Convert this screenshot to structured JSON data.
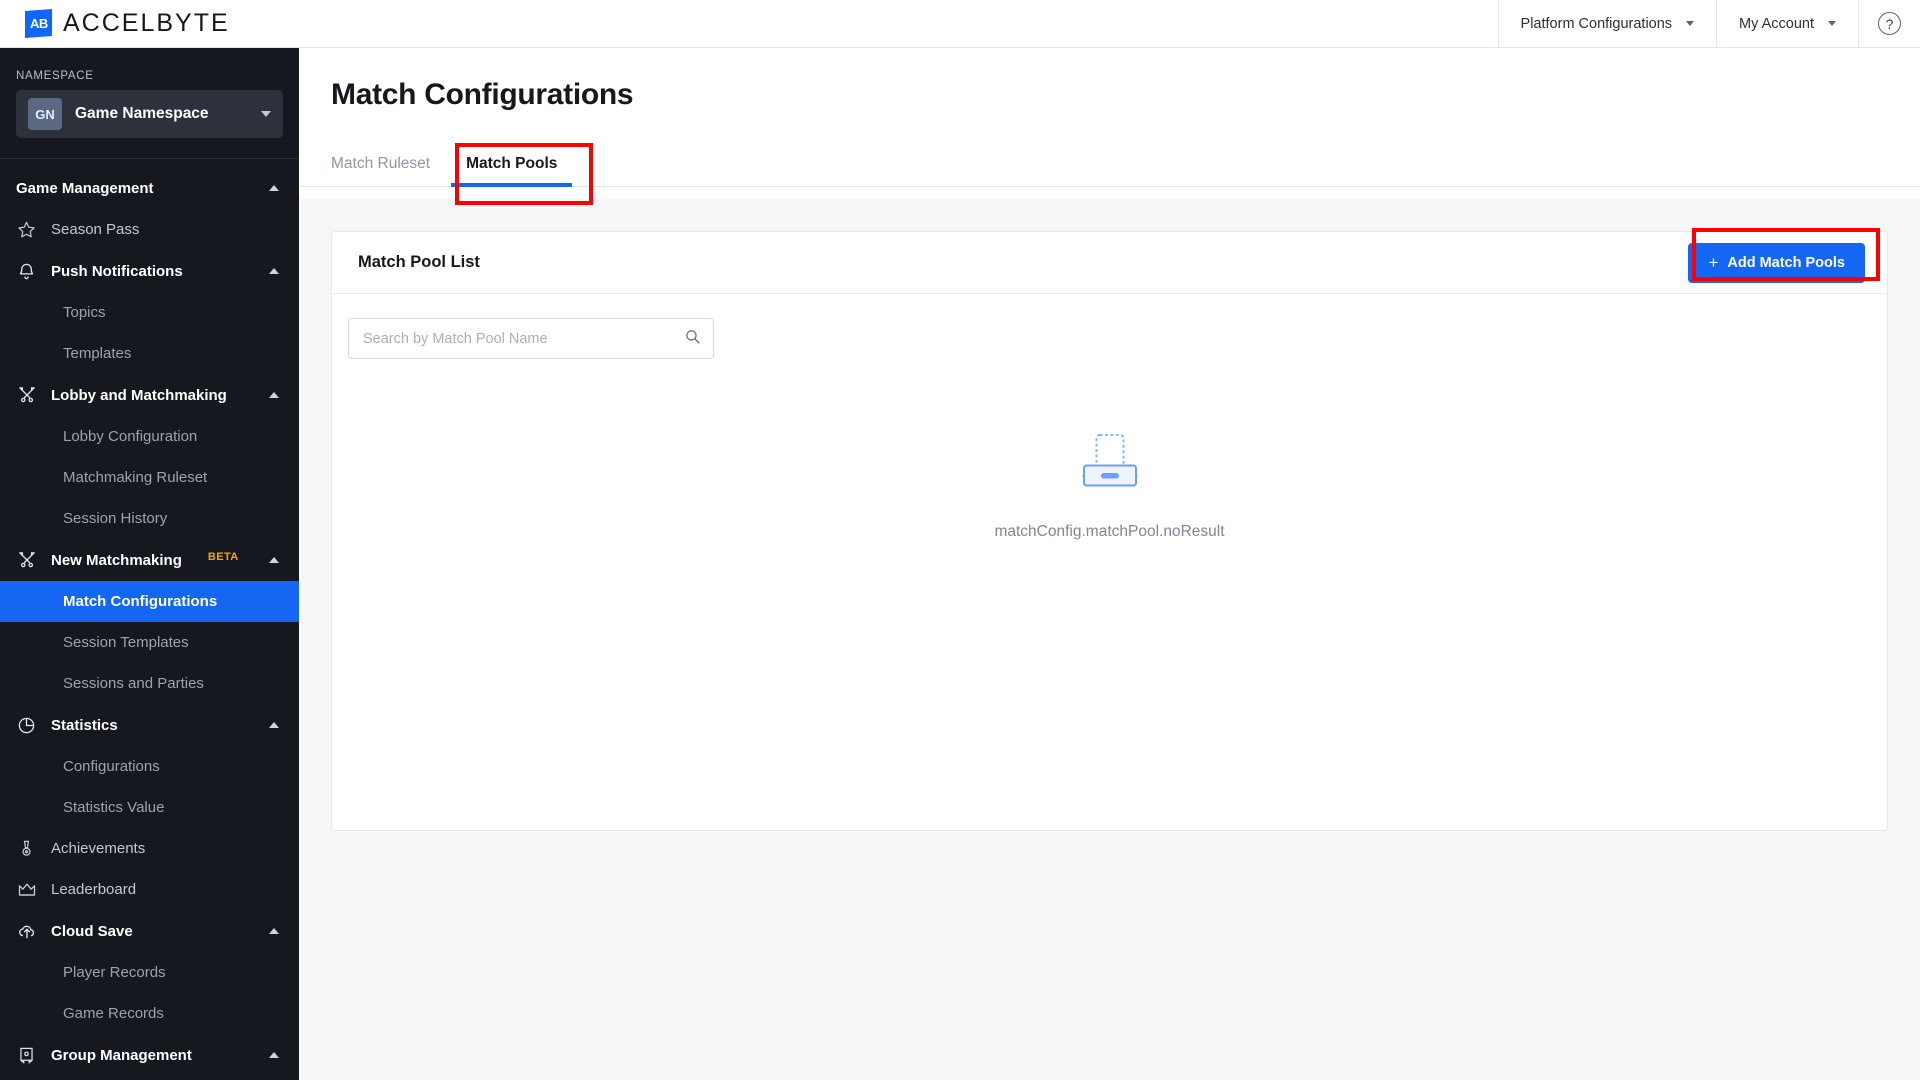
{
  "brand": {
    "mark": "AB",
    "name": "ACCELBYTE"
  },
  "topnav": {
    "items": [
      {
        "label": "Platform Configurations",
        "icon": "chevron-down-icon"
      },
      {
        "label": "My Account",
        "icon": "chevron-down-icon"
      }
    ],
    "help_icon": "help-circle-icon",
    "help_glyph": "?"
  },
  "sidebar": {
    "namespace_label": "NAMESPACE",
    "namespace": {
      "badge": "GN",
      "name": "Game Namespace",
      "icon": "chevron-down-icon"
    },
    "sections": [
      {
        "label": "Game Management",
        "type": "group",
        "icon": null,
        "expanded": true,
        "children": [
          {
            "label": "Season Pass",
            "icon": "star-icon",
            "level": "top"
          },
          {
            "label": "Push Notifications",
            "icon": "bell-icon",
            "level": "top",
            "expandable": true
          }
        ]
      },
      {
        "label": "Topics",
        "level": "sub"
      },
      {
        "label": "Templates",
        "level": "sub"
      },
      {
        "label": "Lobby and Matchmaking",
        "icon": "crossed-swords-icon",
        "type": "group",
        "expanded": true
      },
      {
        "label": "Lobby Configuration",
        "level": "sub"
      },
      {
        "label": "Matchmaking Ruleset",
        "level": "sub"
      },
      {
        "label": "Session History",
        "level": "sub"
      },
      {
        "label": "New Matchmaking",
        "icon": "crossed-swords-icon",
        "type": "group",
        "expanded": true,
        "badge": "BETA"
      },
      {
        "label": "Match Configurations",
        "level": "sub",
        "active": true
      },
      {
        "label": "Session Templates",
        "level": "sub"
      },
      {
        "label": "Sessions and Parties",
        "level": "sub"
      },
      {
        "label": "Statistics",
        "icon": "pie-chart-icon",
        "type": "group",
        "expanded": true
      },
      {
        "label": "Configurations",
        "level": "sub"
      },
      {
        "label": "Statistics Value",
        "level": "sub"
      },
      {
        "label": "Achievements",
        "icon": "medal-icon",
        "level": "top"
      },
      {
        "label": "Leaderboard",
        "icon": "crown-icon",
        "level": "top"
      },
      {
        "label": "Cloud Save",
        "icon": "cloud-upload-icon",
        "type": "group",
        "expanded": true
      },
      {
        "label": "Player Records",
        "level": "sub"
      },
      {
        "label": "Game Records",
        "level": "sub"
      },
      {
        "label": "Group Management",
        "icon": "banner-icon",
        "type": "group",
        "expanded": true
      }
    ],
    "items": {
      "game_management": "Game Management",
      "season_pass": "Season Pass",
      "push_notifications": "Push Notifications",
      "topics": "Topics",
      "templates": "Templates",
      "lobby_and_matchmaking": "Lobby and Matchmaking",
      "lobby_configuration": "Lobby Configuration",
      "matchmaking_ruleset": "Matchmaking Ruleset",
      "session_history": "Session History",
      "new_matchmaking": "New Matchmaking",
      "new_matchmaking_badge": "BETA",
      "match_configurations": "Match Configurations",
      "session_templates": "Session Templates",
      "sessions_and_parties": "Sessions and Parties",
      "statistics": "Statistics",
      "configurations": "Configurations",
      "statistics_value": "Statistics Value",
      "achievements": "Achievements",
      "leaderboard": "Leaderboard",
      "cloud_save": "Cloud Save",
      "player_records": "Player Records",
      "game_records": "Game Records",
      "group_management": "Group Management"
    }
  },
  "page": {
    "title": "Match Configurations",
    "tabs": [
      {
        "label": "Match Ruleset",
        "active": false
      },
      {
        "label": "Match Pools",
        "active": true
      }
    ],
    "tab_labels": {
      "match_ruleset": "Match Ruleset",
      "match_pools": "Match Pools"
    }
  },
  "card": {
    "title": "Match Pool List",
    "add_button": {
      "label": "Add Match Pools",
      "plus": "+"
    },
    "search": {
      "placeholder": "Search by Match Pool Name",
      "value": "",
      "icon": "search-icon"
    },
    "empty_state": {
      "icon": "empty-tray-icon",
      "text": "matchConfig.matchPool.noResult"
    }
  },
  "annotations": {
    "highlight_color": "#ff0000",
    "boxes": [
      {
        "target": "tab-match-pools"
      },
      {
        "target": "add-match-pools-button"
      }
    ]
  },
  "colors": {
    "accent_blue": "#1566f2",
    "sidebar_bg": "#15181e",
    "content_bg": "#f4f6f8",
    "beta_orange": "#f0a800",
    "highlight_red": "#ff0000"
  }
}
